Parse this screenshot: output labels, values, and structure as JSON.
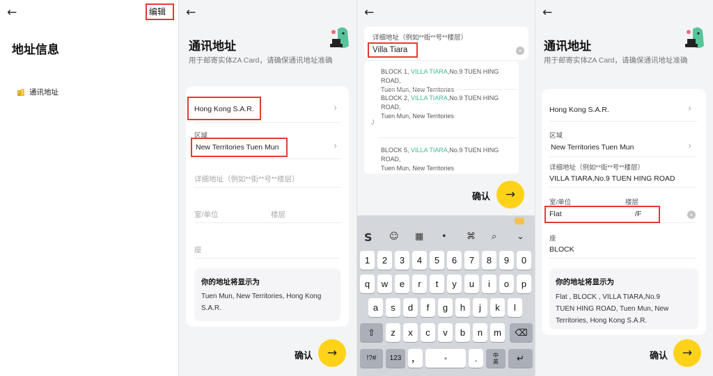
{
  "p1": {
    "back_icon": "←",
    "edit_label": "编辑",
    "title": "地址信息",
    "address_item": "通讯地址",
    "address_icon": "building-icon"
  },
  "p2": {
    "back_icon": "←",
    "title": "通讯地址",
    "subtitle": "用于邮寄实体ZA Card，请确保通讯地址准确",
    "country": "Hong Kong S.A.R.",
    "region_label": "区域",
    "region_value": "New Territories Tuen Mun",
    "detail_placeholder": "详细地址（例如**街**号**楼层）",
    "room_placeholder": "室/单位",
    "floor_placeholder": "楼层",
    "block_placeholder": "座",
    "preview_title": "你的地址将显示为",
    "preview_line1": "Tuen Mun, New Territories, Hong Kong",
    "preview_line2": "S.A.R.",
    "confirm_label": "确认",
    "chevron": "›"
  },
  "p3": {
    "back_icon": "←",
    "detail_label": "详细地址（例如**街**号**楼层）",
    "detail_value": "Villa Tiara",
    "clear_icon": "×",
    "suggestions": [
      {
        "pre": "BLOCK 1, ",
        "hl": "VILLA TIARA",
        "post": ",No.9 TUEN HING ROAD,",
        "line2": "Tuen Mun, New Territories"
      },
      {
        "pre": "BLOCK 2, ",
        "hl": "VILLA TIARA",
        "post": ",No.9 TUEN HING ROAD,",
        "line2": "Tuen Mun, New Territories"
      },
      {
        "pre": "BLOCK 5, ",
        "hl": "VILLA TIARA",
        "post": ",No.9 TUEN HING ROAD,",
        "line2": "Tuen Mun, New Territories"
      }
    ],
    "partial_marker": "J",
    "confirm_label": "确认",
    "keyboard": {
      "row_numbers": [
        "1",
        "2",
        "3",
        "4",
        "5",
        "6",
        "7",
        "8",
        "9",
        "0"
      ],
      "row_q": [
        "q",
        "w",
        "e",
        "r",
        "t",
        "y",
        "u",
        "i",
        "o",
        "p"
      ],
      "row_a": [
        "a",
        "s",
        "d",
        "f",
        "g",
        "h",
        "j",
        "k",
        "l"
      ],
      "row_z": [
        "z",
        "x",
        "c",
        "v",
        "b",
        "n",
        "m"
      ],
      "shift": "⇧",
      "backspace": "⌫",
      "symbols": "!?#",
      "numeric": "123",
      "comma": "，",
      "mic": "•",
      "period": ".",
      "lang_top": "中",
      "lang_bottom": "英",
      "enter": "↵"
    },
    "toolbar_glyphs": [
      "S",
      "☺",
      "▦",
      "•",
      "⌘",
      "⌕",
      "⌄"
    ]
  },
  "p4": {
    "back_icon": "←",
    "title": "通讯地址",
    "subtitle": "用于邮寄实体ZA Card，请确保通讯地址准确",
    "country": "Hong Kong S.A.R.",
    "region_label": "区域",
    "region_value": "New Territories Tuen Mun",
    "detail_label": "详细地址（例如**街**号**楼层）",
    "detail_value": "VILLA TIARA,No.9 TUEN HING ROAD",
    "room_label": "室/单位",
    "floor_label": "楼层",
    "room_value": "Flat",
    "floor_value": "/F",
    "block_label": "座",
    "block_value": "BLOCK",
    "preview_title": "你的地址将显示为",
    "preview_line1": "Flat  , BLOCK  , VILLA TIARA,No.9",
    "preview_line2": "TUEN HING ROAD, Tuen Mun, New",
    "preview_line3": "Territories, Hong Kong S.A.R.",
    "confirm_label": "确认",
    "chevron": "›",
    "clear_icon": "×"
  },
  "colors": {
    "accent": "#ffd21a",
    "highlight_box": "#e53935",
    "suggestion_match": "#3dbb8a",
    "mascot": "#57c49a"
  }
}
